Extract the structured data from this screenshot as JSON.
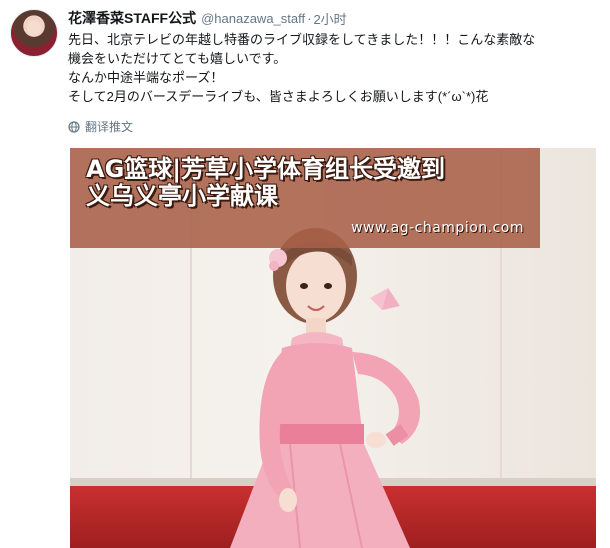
{
  "tweet": {
    "display_name": "花澤香菜STAFF公式",
    "handle": "@hanazawa_staff",
    "separator": "·",
    "time": "2小时",
    "text_lines": [
      "先日、北京テレビの年越し特番のライブ収録をしてきました！！！こんな素敵な",
      "機会をいただけてとても嬉しいです。",
      "なんか中途半端なポーズ！",
      "そして2月のバースデーライブも、皆さまよろしくお願いします(*´ω`*)花"
    ],
    "translate_label": "翻译推文",
    "translate_icon": "globe-icon"
  },
  "overlay": {
    "title_line1": "AG篮球|芳草小学体育组长受邀到",
    "title_line2": "义乌义亭小学献课",
    "url": "www.ag-champion.com"
  },
  "colors": {
    "muted_text": "#657786",
    "overlay_bg": "#a86048",
    "dress_pink": "#f2a3b4",
    "floor_red": "#b52626"
  }
}
